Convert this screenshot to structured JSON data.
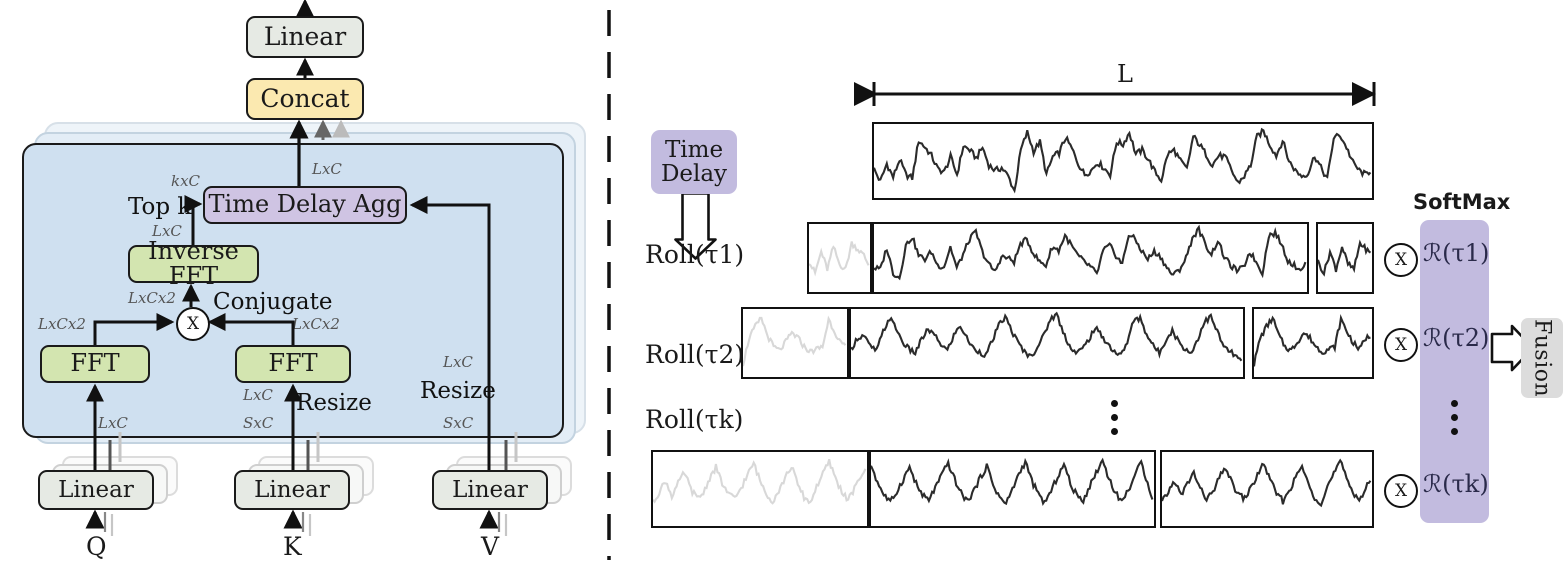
{
  "figure": {
    "left_panel": {
      "blocks": {
        "linear_top": "Linear",
        "concat": "Concat",
        "time_delay_agg": "Time Delay Agg",
        "inverse_fft": "Inverse FFT",
        "fft_left": "FFT",
        "fft_right": "FFT",
        "linear_q": "Linear",
        "linear_k": "Linear",
        "linear_v": "Linear",
        "multiply": "X"
      },
      "operations": {
        "top_k": "Top k",
        "conjugate": "Conjugate",
        "resize_k": "Resize",
        "resize_v": "Resize"
      },
      "dims": {
        "agg_out": "LxC",
        "topk_out": "kxC",
        "ifft_out": "LxC",
        "mul_out": "LxCx2",
        "fft_left_out": "LxCx2",
        "fft_right_out": "LxCx2",
        "q_in": "LxC",
        "k_resized": "LxC",
        "k_in": "SxC",
        "v_resized": "LxC",
        "v_in": "SxC"
      },
      "inputs": {
        "q": "Q",
        "k": "K",
        "v": "V"
      }
    },
    "right_panel": {
      "time_delay_label": "Time\nDelay",
      "length_label": "L",
      "softmax_label": "SoftMax",
      "fusion_label": "Fusion",
      "ellipsis": "⋮",
      "rows": [
        {
          "name": "row-series-original",
          "label": ""
        },
        {
          "name": "row-roll-tau1",
          "label": "Roll(τ1)"
        },
        {
          "name": "row-roll-tau2",
          "label": "Roll(τ2)"
        },
        {
          "name": "row-roll-tauk",
          "label": "Roll(τk)"
        }
      ],
      "correlations": [
        {
          "name": "corr-tau1",
          "label": "ℛ(τ1)"
        },
        {
          "name": "corr-tau2",
          "label": "ℛ(τ2)"
        },
        {
          "name": "corr-tauk",
          "label": "ℛ(τk)"
        }
      ],
      "multiply_symbol": "X"
    },
    "colors": {
      "panel_blue": "#cfe0f0",
      "block_grey": "#e6eae4",
      "block_yellow": "#fbe9b0",
      "block_green": "#d3e5b0",
      "block_purple": "#cfc4e3",
      "softmax_purple": "#c2bbdf",
      "fusion_grey": "#dcdcdc",
      "line_black": "#111111",
      "ghost_series": "#d8d8d8"
    }
  },
  "chart_data": {
    "type": "line",
    "title": "",
    "xlabel": "",
    "ylabel": "",
    "description": "Auto-correlation time-delay aggregation: an original series of length L and three rolled (time-shifted) copies Roll(tau1), Roll(tau2), Roll(tauk), each multiplied by a SoftMax correlation weight R(tau).",
    "series": [
      {
        "name": "original",
        "values": [
          38,
          20,
          46,
          26,
          52,
          30,
          25,
          80,
          70,
          58,
          38,
          34,
          56,
          30,
          72,
          66,
          54,
          70,
          44,
          36,
          40,
          28,
          6,
          66,
          92,
          64,
          78,
          30,
          56,
          62,
          84,
          68,
          46,
          30,
          36,
          48,
          40,
          30,
          78,
          74,
          92,
          60,
          66,
          52,
          34,
          22,
          60,
          66,
          50,
          38,
          86,
          74,
          60,
          44,
          58,
          56,
          36,
          18,
          28,
          44,
          86,
          94,
          74,
          58,
          80,
          50,
          36,
          28,
          32,
          58,
          40,
          24,
          84,
          88,
          70,
          48,
          36,
          30
        ]
      },
      {
        "name": "roll_tau1",
        "values": [
          44,
          26,
          60,
          32,
          68,
          40,
          32,
          74,
          64,
          54,
          34,
          32,
          66,
          26,
          18,
          70,
          84,
          54,
          48,
          60,
          38,
          36,
          68,
          34,
          56,
          80,
          92,
          60,
          40,
          28,
          52,
          50,
          44,
          72,
          80,
          58,
          44,
          38,
          68,
          62,
          86,
          70,
          54,
          44,
          36,
          24,
          62,
          70,
          54,
          40,
          88,
          80,
          62,
          48,
          60,
          52,
          34,
          22,
          32,
          50,
          82,
          96,
          72,
          56,
          78,
          52,
          38,
          30,
          34,
          60,
          44,
          26,
          86,
          90,
          72,
          46,
          38,
          32
        ]
      },
      {
        "name": "roll_tau2",
        "values": [
          16,
          58,
          76,
          90,
          62,
          44,
          38,
          52,
          66,
          58,
          44,
          36,
          40,
          44,
          88,
          68,
          50,
          40,
          58,
          62,
          44,
          38,
          68,
          90,
          74,
          52,
          40,
          34,
          56,
          72,
          62,
          48,
          38,
          62,
          78,
          58,
          42,
          36,
          30,
          54,
          78,
          92,
          70,
          50,
          36,
          28,
          44,
          62,
          88,
          96,
          68,
          46,
          34,
          40,
          56,
          74,
          62,
          48,
          36,
          30,
          52,
          86,
          90,
          64,
          46,
          34,
          56,
          70,
          52,
          40,
          34,
          58,
          84,
          92,
          68,
          44,
          36,
          28
        ]
      },
      {
        "name": "roll_tauk",
        "values": [
          30,
          46,
          62,
          40,
          58,
          74,
          50,
          36,
          44,
          66,
          82,
          58,
          42,
          36,
          52,
          70,
          88,
          62,
          44,
          32,
          48,
          66,
          84,
          56,
          38,
          30,
          54,
          72,
          90,
          66,
          46,
          34,
          50,
          68,
          86,
          60,
          42,
          30,
          46,
          64,
          82,
          58,
          40,
          34,
          52,
          70,
          88,
          64,
          44,
          32,
          48,
          66,
          84,
          56,
          38,
          28,
          50,
          72,
          90,
          62,
          42,
          30,
          46,
          68,
          86,
          58,
          40,
          34,
          54,
          74,
          92,
          66,
          44,
          32,
          48,
          70,
          88,
          60
        ]
      }
    ]
  }
}
